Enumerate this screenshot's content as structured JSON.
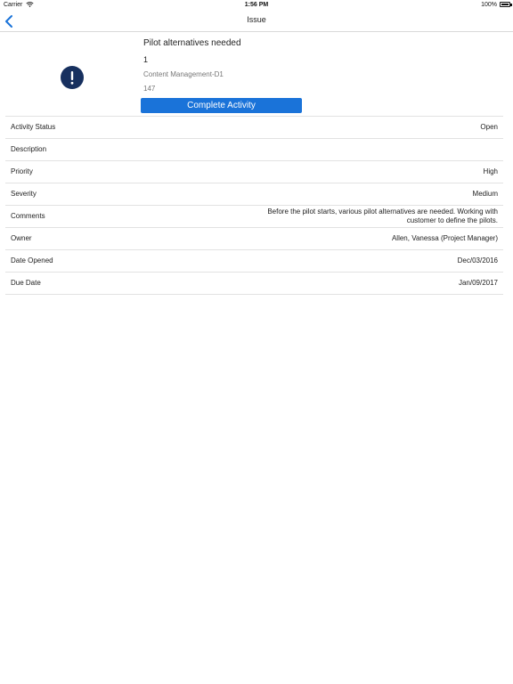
{
  "status_bar": {
    "carrier": "Carrier",
    "time": "1:56 PM",
    "battery": "100%"
  },
  "nav": {
    "title": "Issue"
  },
  "header": {
    "title": "Pilot alternatives needed",
    "number": "1",
    "subtitle": "Content Management-D1",
    "id": "147",
    "button_label": "Complete Activity",
    "icon": "exclamation-icon"
  },
  "fields": [
    {
      "label": "Activity Status",
      "value": "Open"
    },
    {
      "label": "Description",
      "value": ""
    },
    {
      "label": "Priority",
      "value": "High"
    },
    {
      "label": "Severity",
      "value": "Medium"
    },
    {
      "label": "Comments",
      "value": "Before the pilot starts, various pilot alternatives are needed. Working with customer to define the pilots."
    },
    {
      "label": "Owner",
      "value": "Allen, Vanessa (Project Manager)"
    },
    {
      "label": "Date Opened",
      "value": "Dec/03/2016"
    },
    {
      "label": "Due Date",
      "value": "Jan/09/2017"
    }
  ],
  "colors": {
    "accent": "#1a73d9",
    "icon_bg": "#17305f",
    "divider": "#e2e2e2"
  }
}
